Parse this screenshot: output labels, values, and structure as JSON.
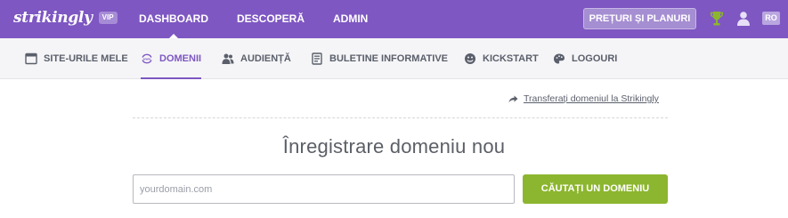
{
  "topbar": {
    "logo": "strikingly",
    "vip": "VIP",
    "nav": [
      {
        "label": "DASHBOARD",
        "active": true
      },
      {
        "label": "DESCOPERĂ",
        "active": false
      },
      {
        "label": "ADMIN",
        "active": false
      }
    ],
    "pricing_label": "PREȚURI ȘI PLANURI",
    "lang": "RO",
    "icons": [
      "trophy-icon",
      "user-icon"
    ],
    "colors": {
      "bar": "#7e57c2",
      "trophy": "#8cb62f"
    }
  },
  "subnav": {
    "items": [
      {
        "label": "SITE-URILE MELE",
        "icon": "window-icon",
        "active": false
      },
      {
        "label": "DOMENII",
        "icon": "www-globe-icon",
        "active": true
      },
      {
        "label": "AUDIENȚĂ",
        "icon": "users-icon",
        "active": false
      },
      {
        "label": "BULETINE INFORMATIVE",
        "icon": "newsletter-icon",
        "active": false
      },
      {
        "label": "KICKSTART",
        "icon": "smiley-icon",
        "active": false
      },
      {
        "label": "LOGOURI",
        "icon": "palette-icon",
        "active": false
      }
    ],
    "colors": {
      "active": "#7e57c2"
    }
  },
  "main": {
    "transfer_link": "Transferați domeniul la Strikingly",
    "title": "Înregistrare domeniu nou",
    "input_placeholder": "yourdomain.com",
    "input_value": "",
    "search_button": "CĂUTAȚI UN DOMENIU",
    "colors": {
      "button": "#8cb62f"
    }
  }
}
